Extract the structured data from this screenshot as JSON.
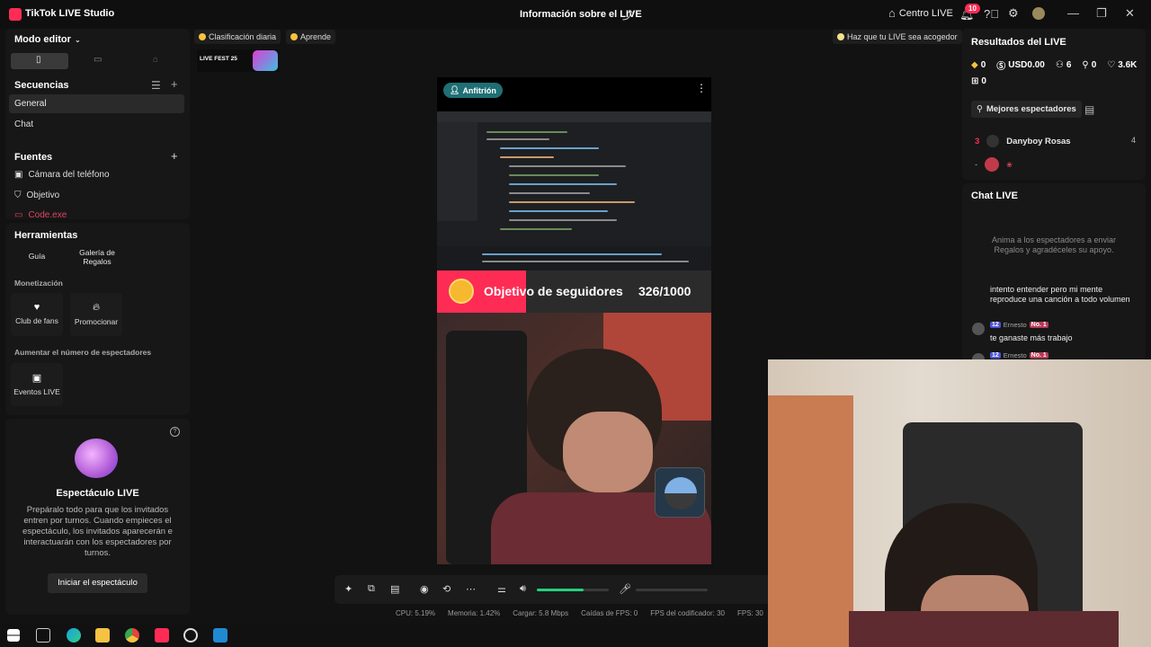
{
  "app": {
    "title": "TikTok LIVE Studio",
    "live_info_title": "Información sobre el LIVE",
    "centro_label": "Centro LIVE",
    "notif_count": "10"
  },
  "left": {
    "mode_label": "Modo editor",
    "sequences_title": "Secuencias",
    "sequences": [
      "General",
      "Chat"
    ],
    "sources_title": "Fuentes",
    "sources": [
      "Cámara del teléfono",
      "Objetivo",
      "Code.exe"
    ],
    "tools_title": "Herramientas",
    "tools": [
      "Guía",
      "Galería de Regalos"
    ],
    "monet_title": "Monetización",
    "monet": [
      "Club de fans",
      "Promocionar"
    ],
    "grow_title": "Aumentar el número de espectadores",
    "grow": [
      "Eventos LIVE"
    ],
    "show_title": "Espectáculo LIVE",
    "show_desc": "Prepáralo todo para que los invitados entren por turnos. Cuando empieces el espectáculo, los invitados aparecerán e interactuarán con los espectadores por turnos.",
    "show_button": "Iniciar el espectáculo"
  },
  "top_chips": {
    "daily": "Clasificación diaria",
    "learn": "Aprende",
    "tip": "Haz que tu LIVE sea acogedor",
    "fest": "LIVE FEST 25"
  },
  "stage": {
    "host_tag": "Anfitrión",
    "goal_label": "Objetivo de seguidores",
    "goal_count": "326/1000"
  },
  "toolbar": {
    "volume_level": 0.65
  },
  "stats": {
    "cpu": "CPU:  5.19%",
    "mem": "Memoria:  1.42%",
    "load": "Cargar:  5.8 Mbps",
    "drops": "Caídas de FPS:  0",
    "enc": "FPS del codificador:  30",
    "fps": "FPS:  30"
  },
  "right": {
    "results_title": "Resultados del LIVE",
    "stats": [
      "0",
      "USD0.00",
      "6",
      "0",
      "3.6K",
      "0"
    ],
    "top_viewers_label": "Mejores espectadores",
    "viewers": [
      {
        "rank": "3",
        "name": "Danyboy Rosas",
        "count": "4"
      },
      {
        "rank": "-",
        "name": "",
        "count": ""
      }
    ],
    "chat_title": "Chat LIVE",
    "chat_empty": "Anima a los espectadores a enviar Regalos y agradéceles su apoyo.",
    "chat_msgs": [
      {
        "text": "intento entender pero mi mente reproduce una canción a todo volumen"
      },
      {
        "level": "12",
        "user": "Ernesto",
        "badge": "No. 1",
        "text": "te ganaste más trabajo"
      },
      {
        "level": "12",
        "user": "Ernesto",
        "badge": "No. 1",
        "text": ""
      }
    ]
  }
}
